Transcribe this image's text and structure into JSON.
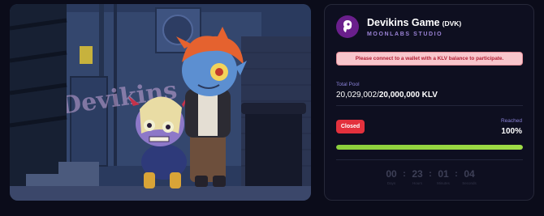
{
  "project": {
    "name": "Devikins Game",
    "ticker": "(DVK)",
    "studio": "MOONLABS STUDIO",
    "logo_icon": "devikins-logo-icon",
    "logo_color": "#6a1f8c"
  },
  "alert": {
    "message": "Please connect to a wallet with a KLV balance to participate."
  },
  "pool": {
    "label": "Total Pool",
    "current": "20,029,002",
    "separator": "/",
    "target": "20,000,000 KLV"
  },
  "status": {
    "badge": "Closed",
    "reached_label": "Reached",
    "reached_value": "100%",
    "progress_fraction": 1.0,
    "progress_color": "#8bcf3c"
  },
  "countdown": {
    "days": "00",
    "hours": "23",
    "minutes": "01",
    "seconds": "04",
    "days_label": "Days",
    "hours_label": "Hours",
    "minutes_label": "Minutes",
    "seconds_label": "Seconds"
  },
  "artwork": {
    "graffiti_text": "Devikins"
  }
}
